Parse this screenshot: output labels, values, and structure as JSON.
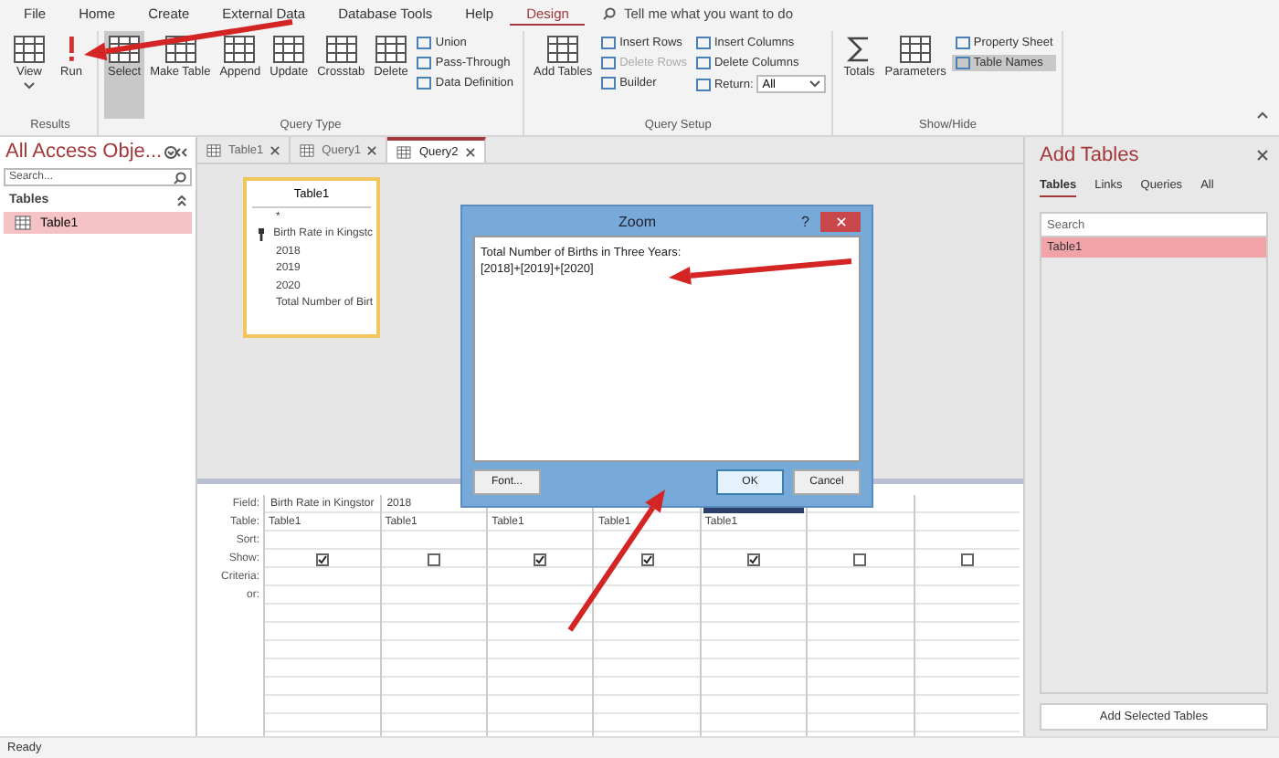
{
  "menu_tabs": [
    {
      "label": "File",
      "selected": false
    },
    {
      "label": "Home",
      "selected": false
    },
    {
      "label": "Create",
      "selected": false
    },
    {
      "label": "External Data",
      "selected": false
    },
    {
      "label": "Database Tools",
      "selected": false
    },
    {
      "label": "Help",
      "selected": false
    },
    {
      "label": "Design",
      "selected": true
    }
  ],
  "tell_me": {
    "placeholder": "Tell me what you want to do"
  },
  "ribbon": {
    "groups": [
      {
        "label": "Results",
        "items": [
          {
            "kind": "large",
            "label": "View",
            "selected": false,
            "disabled": false
          },
          {
            "kind": "large",
            "label": "Run",
            "selected": false,
            "disabled": false
          }
        ]
      },
      {
        "label": "Query Type",
        "items": [
          {
            "kind": "large",
            "label": "Select",
            "selected": true,
            "disabled": false
          },
          {
            "kind": "large",
            "label": "Make Table",
            "selected": false,
            "disabled": false
          },
          {
            "kind": "large",
            "label": "Append",
            "selected": false,
            "disabled": false
          },
          {
            "kind": "large",
            "label": "Update",
            "selected": false,
            "disabled": false
          },
          {
            "kind": "large",
            "label": "Crosstab",
            "selected": false,
            "disabled": false
          },
          {
            "kind": "large",
            "label": "Delete",
            "selected": false,
            "disabled": false
          },
          {
            "kind": "small",
            "label": "Union",
            "selected": false,
            "disabled": false
          },
          {
            "kind": "small",
            "label": "Pass-Through",
            "selected": false,
            "disabled": false
          },
          {
            "kind": "small",
            "label": "Data Definition",
            "selected": false,
            "disabled": false
          }
        ]
      },
      {
        "label": "Query Setup",
        "items": [
          {
            "kind": "large",
            "label": "Add Tables",
            "selected": false,
            "disabled": false
          },
          {
            "kind": "small",
            "label": "Insert Rows",
            "selected": false,
            "disabled": false
          },
          {
            "kind": "small",
            "label": "Delete Rows",
            "selected": false,
            "disabled": true
          },
          {
            "kind": "small",
            "label": "Builder",
            "selected": false,
            "disabled": false
          },
          {
            "kind": "small",
            "label": "Insert Columns",
            "selected": false,
            "disabled": false
          },
          {
            "kind": "small",
            "label": "Delete Columns",
            "selected": false,
            "disabled": false
          },
          {
            "kind": "select",
            "label": "Return:",
            "value": "All",
            "selected": false,
            "disabled": false
          }
        ]
      },
      {
        "label": "Show/Hide",
        "items": [
          {
            "kind": "large",
            "label": "Totals",
            "selected": false,
            "disabled": false
          },
          {
            "kind": "large",
            "label": "Parameters",
            "selected": false,
            "disabled": false
          },
          {
            "kind": "small",
            "label": "Property Sheet",
            "selected": false,
            "disabled": false
          },
          {
            "kind": "small",
            "label": "Table Names",
            "selected": true,
            "disabled": false
          }
        ]
      }
    ]
  },
  "nav_pane": {
    "title": "All Access Obje...",
    "search": {
      "placeholder": "Search..."
    },
    "section": "Tables",
    "items": [
      {
        "label": "Table1",
        "selected": true
      }
    ]
  },
  "doc_tabs": [
    {
      "label": "Table1",
      "selected": false
    },
    {
      "label": "Query1",
      "selected": false
    },
    {
      "label": "Query2",
      "selected": true
    }
  ],
  "field_list": {
    "title": "Table1",
    "fields": [
      {
        "name": "*",
        "key": false
      },
      {
        "name": "Birth Rate in Kingstc",
        "key": true
      },
      {
        "name": "2018",
        "key": false
      },
      {
        "name": "2019",
        "key": false
      },
      {
        "name": "2020",
        "key": false
      },
      {
        "name": "Total Number of Birt",
        "key": false
      }
    ]
  },
  "zoom_dialog": {
    "title": "Zoom",
    "help": "?",
    "text": "Total Number of Births in Three Years:[2018]+[2019]+[2020]",
    "buttons": [
      {
        "label": "Font...",
        "default": false
      },
      {
        "label": "OK",
        "default": true
      },
      {
        "label": "Cancel",
        "default": false
      }
    ]
  },
  "query_grid": {
    "row_labels": [
      "Field:",
      "Table:",
      "Sort:",
      "Show:",
      "Criteria:",
      "or:"
    ],
    "columns": [
      {
        "field": "Birth Rate in Kingstor",
        "table": "Table1",
        "show": true,
        "selected": false
      },
      {
        "field": "2018",
        "table": "Table1",
        "show": false,
        "selected": false
      },
      {
        "table": "Table1",
        "show": true,
        "selected": false
      },
      {
        "table": "Table1",
        "show": true,
        "selected": false
      },
      {
        "table": "Table1",
        "show": true,
        "selected": true
      },
      {
        "show": false,
        "selected": false
      },
      {
        "show": false,
        "selected": false
      }
    ]
  },
  "add_tables": {
    "title": "Add Tables",
    "tabs": [
      {
        "label": "Tables",
        "selected": true
      },
      {
        "label": "Links",
        "selected": false
      },
      {
        "label": "Queries",
        "selected": false
      },
      {
        "label": "All",
        "selected": false
      }
    ],
    "search": {
      "placeholder": "Search"
    },
    "items": [
      {
        "label": "Table1",
        "selected": true
      }
    ],
    "button": "Add Selected Tables"
  },
  "status_bar": {
    "text": "Ready"
  }
}
